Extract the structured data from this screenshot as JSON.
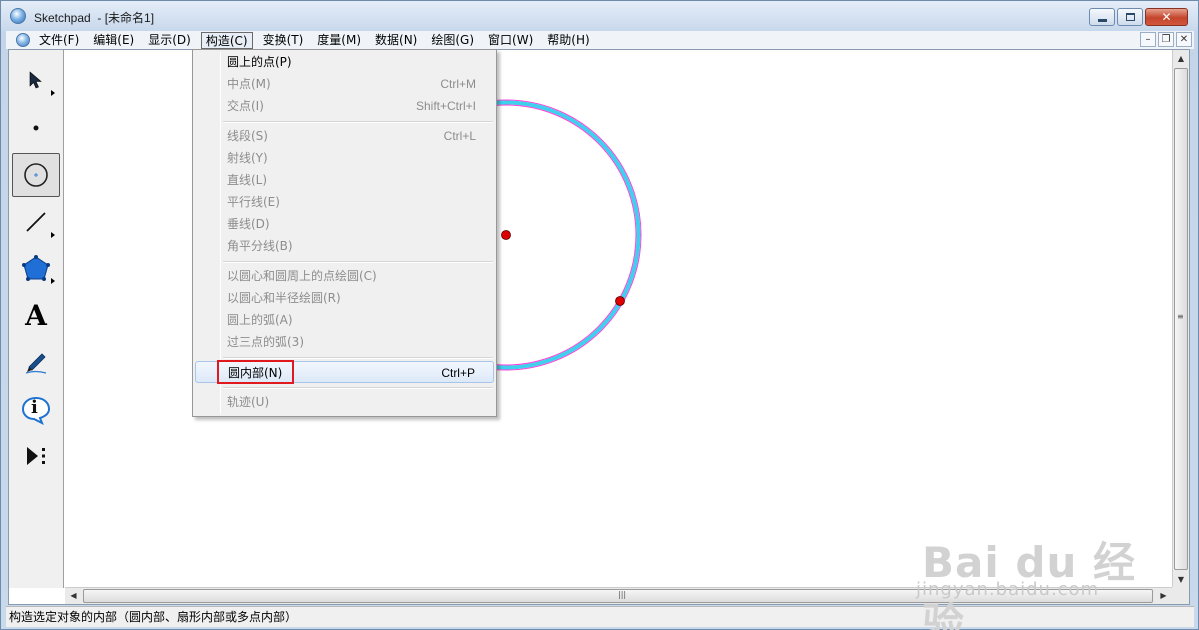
{
  "window": {
    "app_name": "Sketchpad",
    "doc_title": "- [未命名1]"
  },
  "menubar": {
    "items": [
      {
        "label": "文件(F)"
      },
      {
        "label": "编辑(E)"
      },
      {
        "label": "显示(D)"
      },
      {
        "label": "构造(C)",
        "active": true
      },
      {
        "label": "变换(T)"
      },
      {
        "label": "度量(M)"
      },
      {
        "label": "数据(N)"
      },
      {
        "label": "绘图(G)"
      },
      {
        "label": "窗口(W)"
      },
      {
        "label": "帮助(H)"
      }
    ]
  },
  "construct_menu": {
    "items": [
      {
        "label": "圆上的点(P)",
        "shortcut": "",
        "enabled": true
      },
      {
        "label": "中点(M)",
        "shortcut": "Ctrl+M",
        "enabled": false
      },
      {
        "label": "交点(I)",
        "shortcut": "Shift+Ctrl+I",
        "enabled": false
      },
      {
        "label": "线段(S)",
        "shortcut": "Ctrl+L",
        "enabled": false
      },
      {
        "label": "射线(Y)",
        "shortcut": "",
        "enabled": false
      },
      {
        "label": "直线(L)",
        "shortcut": "",
        "enabled": false
      },
      {
        "label": "平行线(E)",
        "shortcut": "",
        "enabled": false
      },
      {
        "label": "垂线(D)",
        "shortcut": "",
        "enabled": false
      },
      {
        "label": "角平分线(B)",
        "shortcut": "",
        "enabled": false
      },
      {
        "label": "以圆心和圆周上的点绘圆(C)",
        "shortcut": "",
        "enabled": false
      },
      {
        "label": "以圆心和半径绘圆(R)",
        "shortcut": "",
        "enabled": false
      },
      {
        "label": "圆上的弧(A)",
        "shortcut": "",
        "enabled": false
      },
      {
        "label": "过三点的弧(3)",
        "shortcut": "",
        "enabled": false
      },
      {
        "label": "圆内部(N)",
        "shortcut": "Ctrl+P",
        "enabled": true,
        "highlighted": true
      },
      {
        "label": "轨迹(U)",
        "shortcut": "",
        "enabled": false
      }
    ]
  },
  "toolbox": {
    "tools": [
      "arrow-tool",
      "point-tool",
      "compass-tool",
      "straightedge-tool",
      "polygon-tool",
      "text-tool",
      "marker-tool",
      "information-tool",
      "custom-tool"
    ],
    "selected": "compass-tool",
    "text_tool_glyph": "A",
    "info_tool_glyph": "i"
  },
  "statusbar": {
    "text": "构造选定对象的内部（圆内部、扇形内部或多点内部）"
  },
  "watermark": {
    "main": "Bai du 经验",
    "sub": "jingyan.baidu.com"
  },
  "colors": {
    "circle_fill_ring": "#3fd0ee",
    "circle_outline": "#ff3fd8",
    "point": "#dd0000",
    "highlight_box": "#e0191f"
  }
}
